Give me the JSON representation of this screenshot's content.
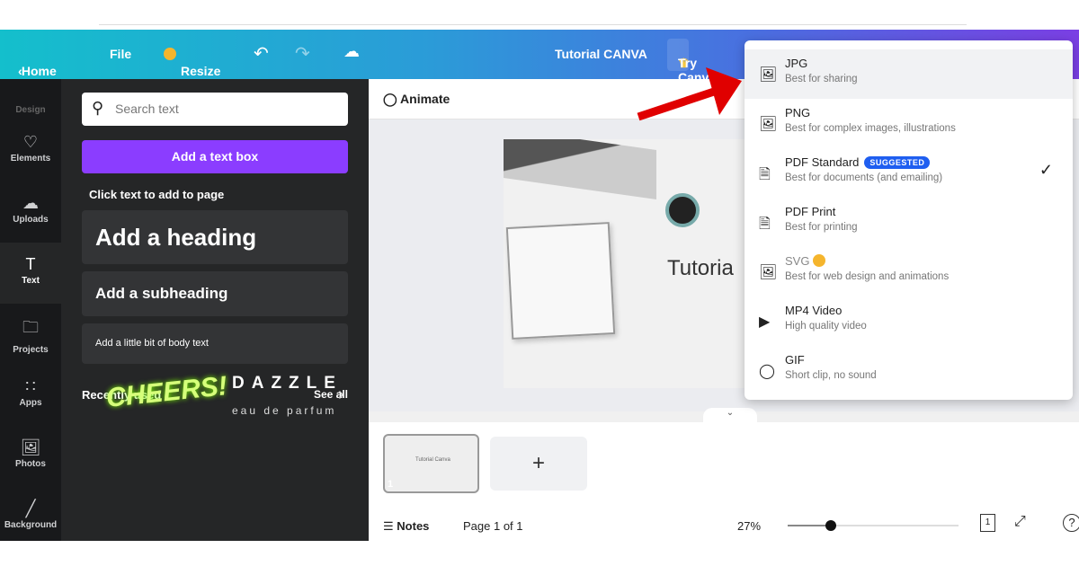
{
  "header": {
    "home": "Home",
    "file": "File",
    "resize": "Resize",
    "title": "Tutorial CANVA",
    "try": "Try Canva"
  },
  "rail": [
    {
      "label": "Design",
      "icon": "layout-icon"
    },
    {
      "label": "Elements",
      "icon": "shapes-icon"
    },
    {
      "label": "Uploads",
      "icon": "cloud-upload-icon"
    },
    {
      "label": "Text",
      "icon": "text-icon",
      "active": true
    },
    {
      "label": "Projects",
      "icon": "folder-icon"
    },
    {
      "label": "Apps",
      "icon": "grid-icon"
    },
    {
      "label": "Photos",
      "icon": "image-icon"
    },
    {
      "label": "Background",
      "icon": "hatch-icon"
    }
  ],
  "panel": {
    "search_placeholder": "Search text",
    "add_text_box": "Add a text box",
    "hint": "Click text to add to page",
    "heading": "Add a heading",
    "subheading": "Add a subheading",
    "body": "Add a little bit of body text",
    "recent": "Recently used",
    "see_all": "See all",
    "sample1": "CHEERS!",
    "sample2_title": "DAZZLE",
    "sample2_sub": "eau de parfum"
  },
  "canvas": {
    "animate": "Animate",
    "design_text": "Tutoria",
    "thumb_text": "Tutorial Canva",
    "page_number": "1"
  },
  "footer": {
    "notes": "Notes",
    "page": "Page 1 of 1",
    "zoom": "27%",
    "zoom_value": 27,
    "pages_count": "1"
  },
  "dropdown": {
    "options": [
      {
        "title": "JPG",
        "sub": "Best for sharing",
        "icon": "image-icon",
        "hover": true
      },
      {
        "title": "PNG",
        "sub": "Best for complex images, illustrations",
        "icon": "image-icon"
      },
      {
        "title": "PDF Standard",
        "badge": "SUGGESTED",
        "sub": "Best for documents (and emailing)",
        "icon": "document-icon",
        "selected": true
      },
      {
        "title": "PDF Print",
        "sub": "Best for printing",
        "icon": "document-icon"
      },
      {
        "title": "SVG",
        "sub": "Best for web design and animations",
        "icon": "image-icon",
        "premium": true
      },
      {
        "title": "MP4 Video",
        "sub": "High quality video",
        "icon": "video-icon"
      },
      {
        "title": "GIF",
        "sub": "Short clip, no sound",
        "icon": "animate-icon"
      }
    ]
  },
  "colors": {
    "accent": "#8b3dff",
    "badge": "#1f5ef0",
    "arrow": "#e00000"
  }
}
